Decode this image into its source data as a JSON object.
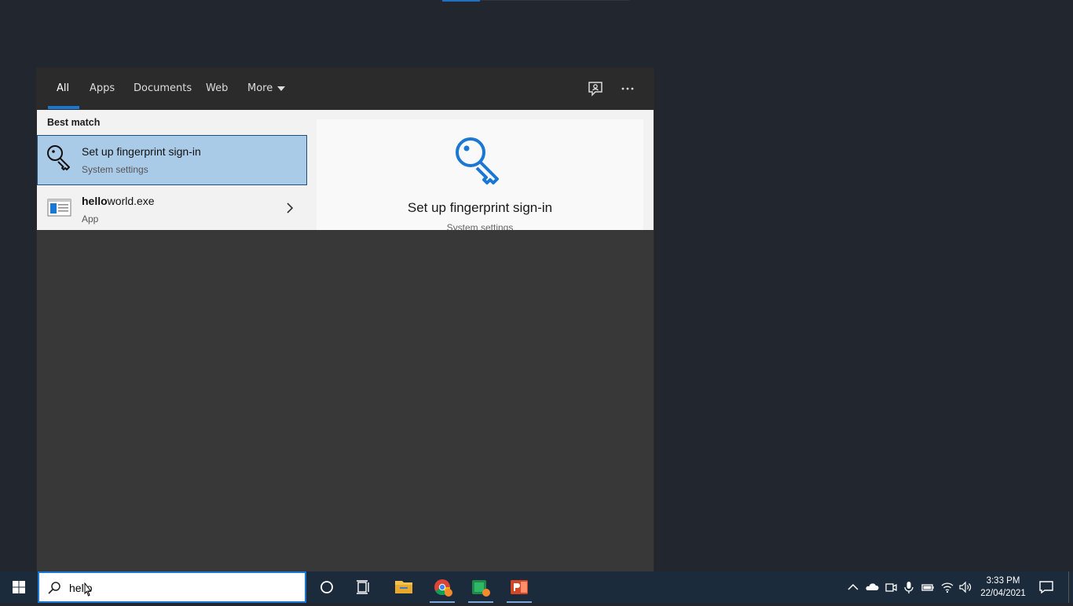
{
  "tabs": [
    {
      "label": "All",
      "active": true
    },
    {
      "label": "Apps",
      "active": false
    },
    {
      "label": "Documents",
      "active": false
    },
    {
      "label": "Web",
      "active": false
    },
    {
      "label": "More",
      "active": false
    }
  ],
  "results": {
    "section_label": "Best match",
    "items": [
      {
        "title": "Set up fingerprint sign-in",
        "subtitle": "System settings",
        "icon": "key-icon",
        "selected": true
      },
      {
        "title_bold": "hello",
        "title_rest": "world.exe",
        "subtitle": "App",
        "icon": "app-window-icon",
        "selected": false
      }
    ]
  },
  "preview": {
    "title": "Set up fingerprint sign-in",
    "subtitle": "System settings",
    "icon": "key-icon",
    "accent": "#1a78d4"
  },
  "search": {
    "value": "hello",
    "icon": "search-icon"
  },
  "taskbar": {
    "background": "#1b2b3c",
    "apps": [
      "cortana-icon",
      "task-view-icon",
      "file-explorer-icon",
      "chrome-icon",
      "green-app-icon",
      "powerpoint-icon"
    ],
    "tray": [
      "chevron-up-icon",
      "onedrive-icon",
      "meet-now-icon",
      "microphone-icon",
      "battery-icon",
      "wifi-icon",
      "volume-icon"
    ],
    "time": "3:33 PM",
    "date": "22/04/2021"
  }
}
